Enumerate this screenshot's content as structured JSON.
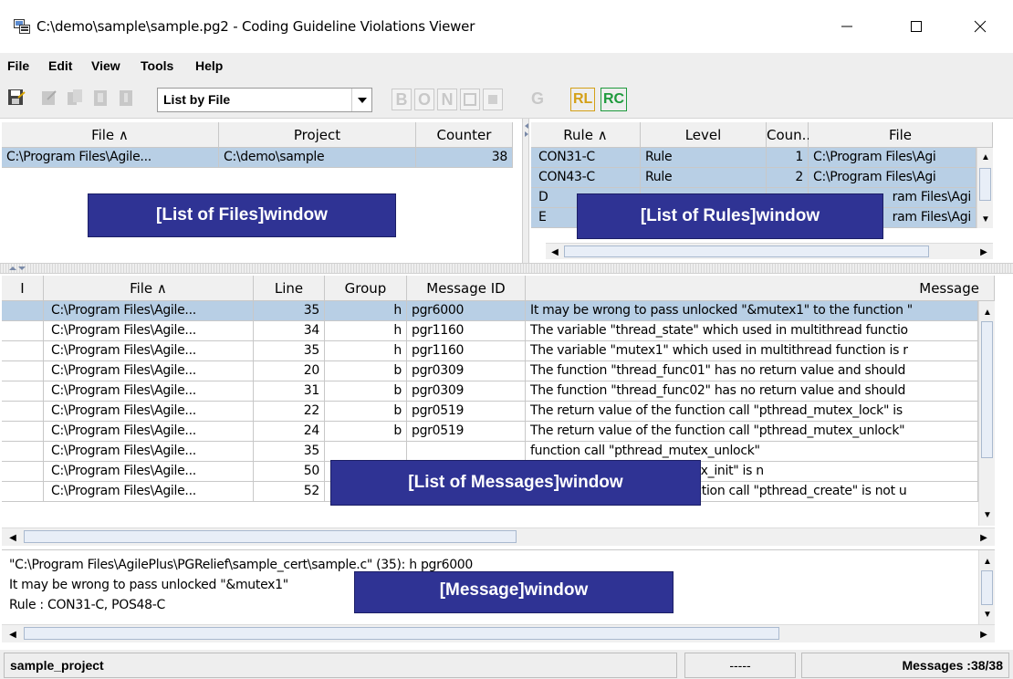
{
  "window": {
    "title": "C:\\demo\\sample\\sample.pg2 - Coding Guideline Violations Viewer",
    "minimize_glyph": "—",
    "maximize_glyph": "☐",
    "close_glyph": "✕"
  },
  "menu": [
    {
      "label": "File"
    },
    {
      "label": "Edit"
    },
    {
      "label": "View"
    },
    {
      "label": "Tools"
    },
    {
      "label": "Help"
    }
  ],
  "toolbar": {
    "view_mode": "List by File",
    "letter_buttons": [
      "B",
      "O",
      "N",
      "",
      "G"
    ],
    "rl_label": "RL",
    "rc_label": "RC"
  },
  "files_pane": {
    "columns": [
      "File ∧",
      "Project",
      "Counter"
    ],
    "rows": [
      {
        "file": "C:\\Program Files\\Agile...",
        "project": "C:\\demo\\sample",
        "counter": "38"
      }
    ],
    "overlay": "[List of Files]window"
  },
  "rules_pane": {
    "columns": [
      "Rule ∧",
      "Level",
      "Coun...",
      "File"
    ],
    "rows": [
      {
        "rule": "CON31-C",
        "level": "Rule",
        "count": "1",
        "file": "C:\\Program Files\\Agi"
      },
      {
        "rule": "CON43-C",
        "level": "Rule",
        "count": "2",
        "file": "C:\\Program Files\\Agi"
      },
      {
        "rule": "D",
        "level": "",
        "count": "",
        "file": "ram Files\\Agi"
      },
      {
        "rule": "E",
        "level": "",
        "count": "",
        "file": "ram Files\\Agi"
      }
    ],
    "overlay": "[List of Rules]window"
  },
  "messages_pane": {
    "columns": [
      "I",
      "File ∧",
      "Line",
      "Group",
      "Message ID",
      "Message"
    ],
    "rows": [
      {
        "file": "C:\\Program Files\\Agile...",
        "line": "35",
        "group": "h",
        "id": "pgr6000",
        "message": "It may be wrong to pass unlocked \"&mutex1\" to the function \""
      },
      {
        "file": "C:\\Program Files\\Agile...",
        "line": "34",
        "group": "h",
        "id": "pgr1160",
        "message": "The variable \"thread_state\" which used in multithread functio"
      },
      {
        "file": "C:\\Program Files\\Agile...",
        "line": "35",
        "group": "h",
        "id": "pgr1160",
        "message": "The variable \"mutex1\" which used in multithread function is r"
      },
      {
        "file": "C:\\Program Files\\Agile...",
        "line": "20",
        "group": "b",
        "id": "pgr0309",
        "message": "The function \"thread_func01\" has no return value and should"
      },
      {
        "file": "C:\\Program Files\\Agile...",
        "line": "31",
        "group": "b",
        "id": "pgr0309",
        "message": "The function \"thread_func02\" has no return value and should"
      },
      {
        "file": "C:\\Program Files\\Agile...",
        "line": "22",
        "group": "b",
        "id": "pgr0519",
        "message": "The return value of the function call \"pthread_mutex_lock\" is"
      },
      {
        "file": "C:\\Program Files\\Agile...",
        "line": "24",
        "group": "b",
        "id": "pgr0519",
        "message": "The return value of the function call \"pthread_mutex_unlock\""
      },
      {
        "file": "C:\\Program Files\\Agile...",
        "line": "35",
        "group": "",
        "id": "",
        "message": "function call \"pthread_mutex_unlock\""
      },
      {
        "file": "C:\\Program Files\\Agile...",
        "line": "50",
        "group": "",
        "id": "",
        "message": "function call \"pthread_mutex_init\" is n"
      },
      {
        "file": "C:\\Program Files\\Agile...",
        "line": "52",
        "group": "b",
        "id": "pgr0519",
        "message": "The return value of the function call \"pthread_create\" is not u"
      }
    ],
    "overlay": "[List of Messages]window"
  },
  "message_window": {
    "lines": [
      "\"C:\\Program Files\\AgilePlus\\PGRelief\\sample_cert\\sample.c\" (35): h pgr6000",
      "It may be wrong to pass unlocked \"&mutex1\"",
      "Rule : CON31-C, POS48-C"
    ],
    "overlay": "[Message]window"
  },
  "status": {
    "project": "sample_project",
    "middle": "-----",
    "messages": "Messages :38/38"
  },
  "colors": {
    "overlay": "#2f3394",
    "selection": "#b8cfe5",
    "rl": "#d4a017",
    "rc": "#1e9a3c"
  }
}
